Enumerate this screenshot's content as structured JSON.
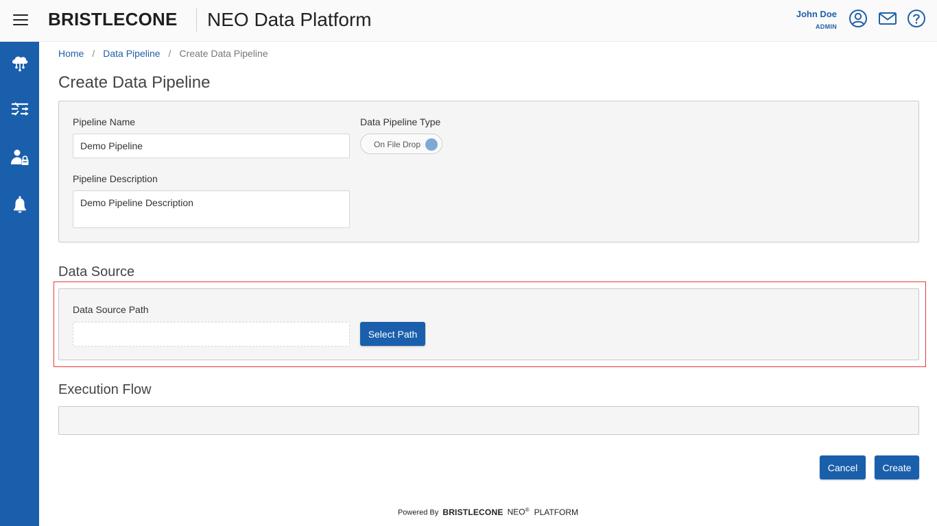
{
  "header": {
    "brand": "BRISTLECONE",
    "app_title": "NEO Data Platform",
    "user_name": "John Doe",
    "user_role": "ADMIN"
  },
  "breadcrumb": {
    "home": "Home",
    "parent": "Data Pipeline",
    "current": "Create Data Pipeline",
    "separator": "/"
  },
  "page": {
    "title": "Create Data Pipeline"
  },
  "pipeline": {
    "name_label": "Pipeline Name",
    "name_value": "Demo Pipeline",
    "type_label": "Data Pipeline Type",
    "type_toggle": "On File Drop",
    "description_label": "Pipeline Description",
    "description_value": "Demo Pipeline Description"
  },
  "data_source": {
    "title": "Data Source",
    "path_label": "Data Source Path",
    "path_value": "",
    "select_button": "Select Path"
  },
  "execution_flow": {
    "title": "Execution Flow"
  },
  "actions": {
    "cancel": "Cancel",
    "create": "Create"
  },
  "footer": {
    "powered_by": "Powered By",
    "brand": "BRISTLECONE",
    "product": "NEO",
    "registered": "®",
    "platform": "PLATFORM"
  },
  "colors": {
    "accent": "#1a5fab",
    "highlight": "#e53935",
    "toggle_knob": "#7ea8d6"
  },
  "icons": {
    "menu": "hamburger-icon",
    "profile": "user-circle-icon",
    "mail": "mail-icon",
    "help": "help-icon",
    "sidebar": [
      "cloud-network-icon",
      "pipeline-flow-icon",
      "user-admin-icon",
      "bell-icon"
    ]
  }
}
